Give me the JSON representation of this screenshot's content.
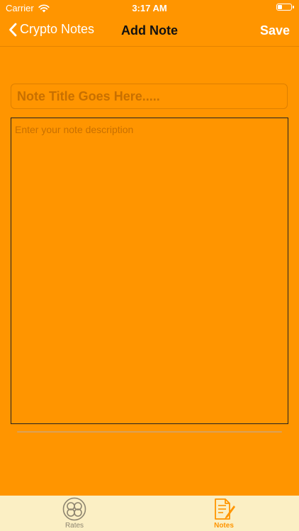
{
  "status_bar": {
    "carrier": "Carrier",
    "time": "3:17 AM",
    "wifi_icon": "wifi-icon",
    "battery_icon": "battery-icon"
  },
  "nav": {
    "back_label": "Crypto Notes",
    "title": "Add Note",
    "save_label": "Save",
    "back_icon": "chevron-left-icon"
  },
  "form": {
    "title_value": "",
    "title_placeholder": "Note Title Goes Here.....",
    "description_value": "",
    "description_placeholder": "Enter your note description"
  },
  "tab_bar": {
    "tabs": [
      {
        "label": "Rates",
        "icon": "rates-icon",
        "selected": false
      },
      {
        "label": "Notes",
        "icon": "notes-icon",
        "selected": true
      }
    ]
  },
  "colors": {
    "background": "#FF9500",
    "tab_bar_background": "#FBEFC4",
    "accent": "#FF9500",
    "nav_title": "#111111",
    "inactive_tab": "#8E8570"
  }
}
